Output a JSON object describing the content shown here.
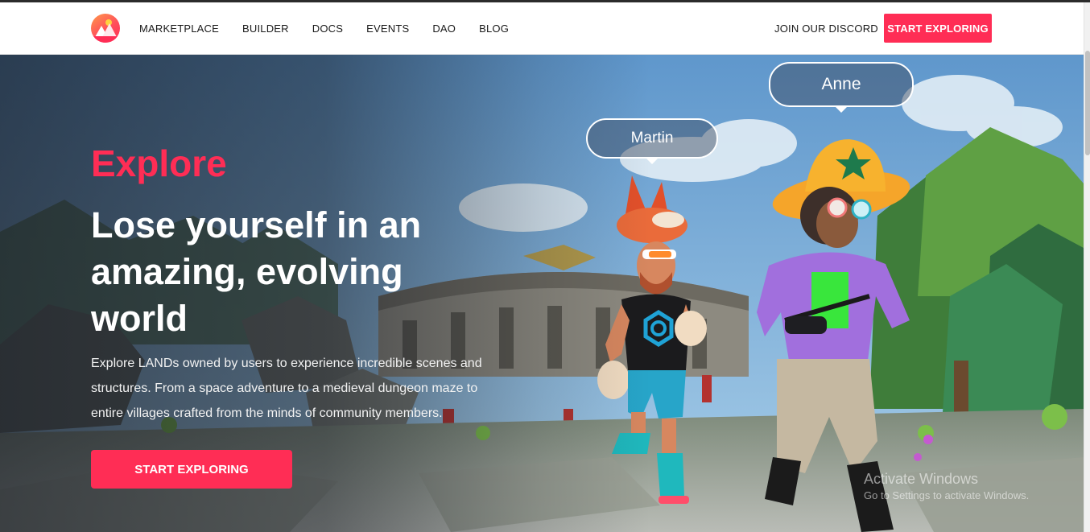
{
  "nav": {
    "logo_icon": "decentraland-logo-icon",
    "links": [
      {
        "label": "MARKETPLACE"
      },
      {
        "label": "BUILDER"
      },
      {
        "label": "DOCS"
      },
      {
        "label": "EVENTS"
      },
      {
        "label": "DAO"
      },
      {
        "label": "BLOG"
      }
    ],
    "discord_label": "JOIN OUR DISCORD",
    "cta_label": "START EXPLORING"
  },
  "hero": {
    "eyebrow": "Explore",
    "headline": "Lose yourself in an amazing, evolving world",
    "body": "Explore LANDs owned by users to experience incredible scenes and structures. From a space adventure to a medieval dungeon maze to entire villages crafted from the minds of community members.",
    "cta_label": "START EXPLORING",
    "avatars": [
      {
        "name": "Martin"
      },
      {
        "name": "Anne"
      }
    ]
  },
  "watermark": {
    "line1": "Activate Windows",
    "line2": "Go to Settings to activate Windows."
  },
  "colors": {
    "accent": "#ff2d55",
    "text_dark": "#1a1a1a",
    "white": "#ffffff"
  }
}
